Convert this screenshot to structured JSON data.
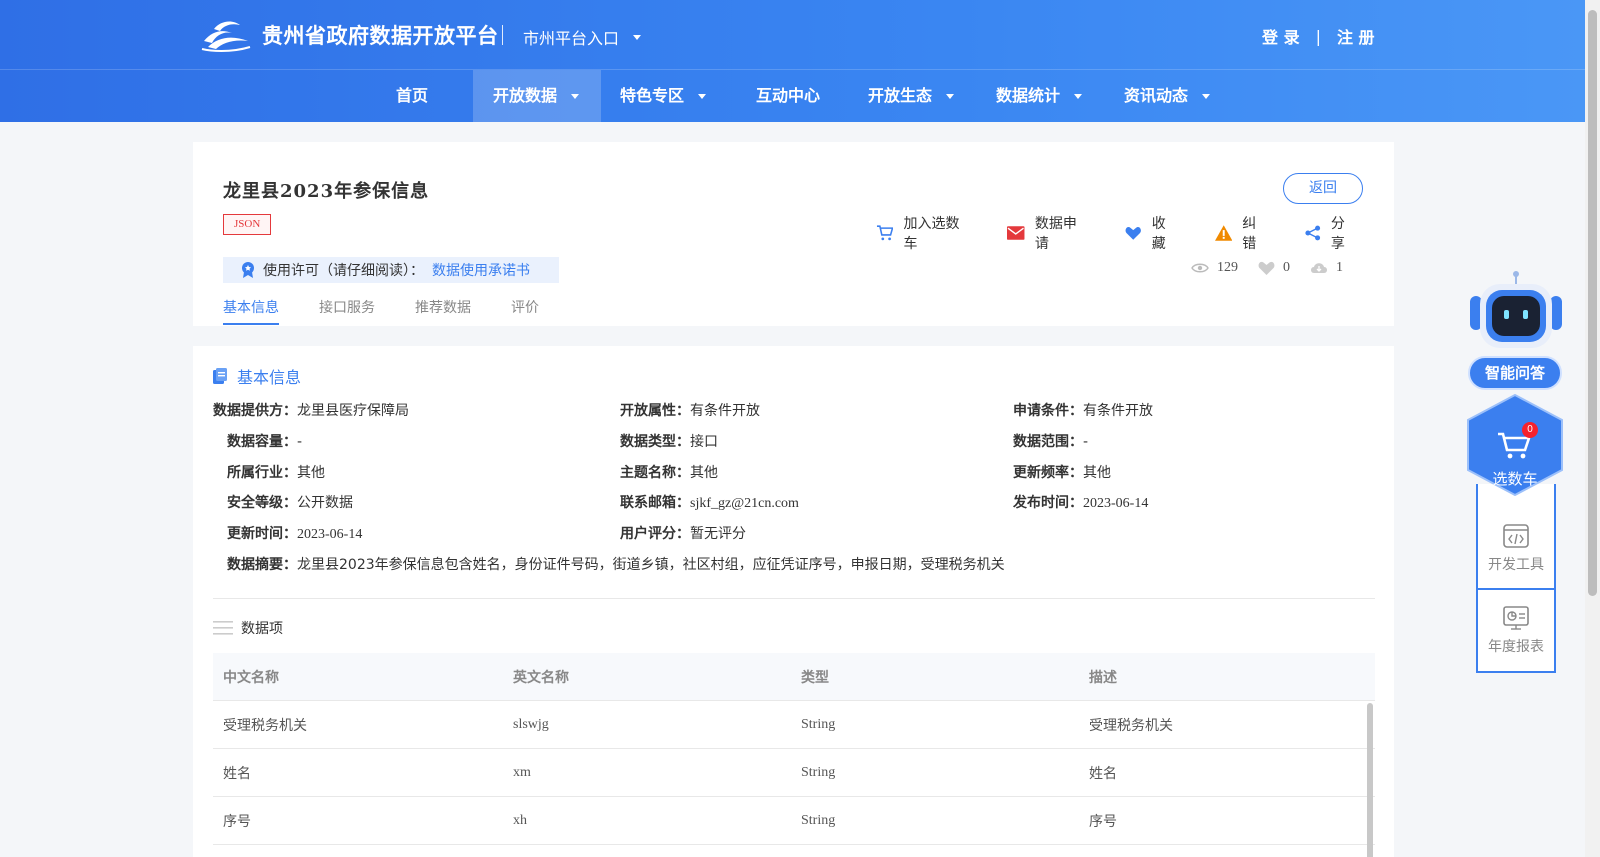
{
  "header": {
    "site_title": "贵州省政府数据开放平台",
    "city_entry": "市州平台入口",
    "login": "登 录",
    "separator": "|",
    "register": "注 册"
  },
  "nav": {
    "items": [
      {
        "label": "首页"
      },
      {
        "label": "开放数据"
      },
      {
        "label": "特色专区"
      },
      {
        "label": "互动中心"
      },
      {
        "label": "开放生态"
      },
      {
        "label": "数据统计"
      },
      {
        "label": "资讯动态"
      }
    ],
    "active": "开放数据"
  },
  "dataset": {
    "title": "龙里县2023年参保信息",
    "format_tag": "JSON",
    "back_label": "返回",
    "actions": {
      "cart": "加入选数车",
      "apply": "数据申请",
      "favorite": "收藏",
      "report": "纠错",
      "share": "分享"
    },
    "license_label": "使用许可（请仔细阅读）：",
    "license_link": "数据使用承诺书",
    "stats": {
      "views": "129",
      "likes": "0",
      "downloads": "1"
    },
    "tabs": [
      "基本信息",
      "接口服务",
      "推荐数据",
      "评价"
    ]
  },
  "basic_info": {
    "section_title": "基本信息",
    "fields": {
      "provider": {
        "label": "数据提供方：",
        "value": "龙里县医疗保障局"
      },
      "open_attr": {
        "label": "开放属性：",
        "value": "有条件开放"
      },
      "apply_cond": {
        "label": "申请条件：",
        "value": "有条件开放"
      },
      "capacity": {
        "label": "数据容量：",
        "value": "-"
      },
      "data_type": {
        "label": "数据类型：",
        "value": "接口"
      },
      "scope": {
        "label": "数据范围：",
        "value": "-"
      },
      "industry": {
        "label": "所属行业：",
        "value": "其他"
      },
      "theme": {
        "label": "主题名称：",
        "value": "其他"
      },
      "frequency": {
        "label": "更新频率：",
        "value": "其他"
      },
      "security": {
        "label": "安全等级：",
        "value": "公开数据"
      },
      "email": {
        "label": "联系邮箱：",
        "value": "sjkf_gz@21cn.com"
      },
      "publish_time": {
        "label": "发布时间：",
        "value": "2023-06-14"
      },
      "update_time": {
        "label": "更新时间：",
        "value": "2023-06-14"
      },
      "rating": {
        "label": "用户评分：",
        "value": "暂无评分"
      },
      "summary": {
        "label": "数据摘要：",
        "value": "龙里县2023年参保信息包含姓名，身份证件号码，街道乡镇，社区村组，应征凭证序号，申报日期，受理税务机关"
      }
    }
  },
  "data_items": {
    "title": "数据项",
    "columns": [
      "中文名称",
      "英文名称",
      "类型",
      "描述"
    ],
    "rows": [
      [
        "受理税务机关",
        "slswjg",
        "String",
        "受理税务机关"
      ],
      [
        "姓名",
        "xm",
        "String",
        "姓名"
      ],
      [
        "序号",
        "xh",
        "String",
        "序号"
      ]
    ]
  },
  "sidebar": {
    "ask_label": "智能问答",
    "cart_label": "选数车",
    "cart_count": "0",
    "dev_tools": "开发工具",
    "annual_report": "年度报表"
  },
  "colors": {
    "brand_blue": "#3b7fef",
    "header_gradient_start": "#2f6fe6",
    "header_gradient_end": "#4a97f6",
    "danger": "#e4393c"
  }
}
